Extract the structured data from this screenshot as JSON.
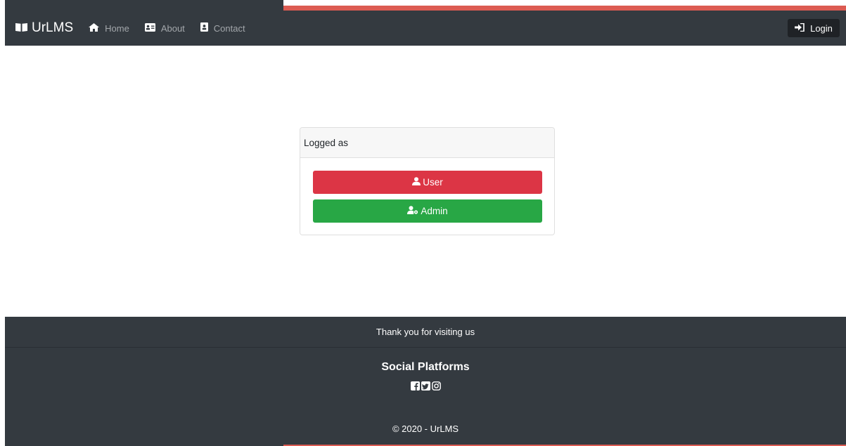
{
  "navbar": {
    "brand": "UrLMS",
    "links": [
      {
        "label": "Home",
        "icon": "home-icon"
      },
      {
        "label": "About",
        "icon": "id-card-icon"
      },
      {
        "label": "Contact",
        "icon": "address-book-icon"
      }
    ],
    "login_label": "Login"
  },
  "card": {
    "header": "Logged as",
    "user_label": "User",
    "admin_label": "Admin"
  },
  "footer": {
    "thanks": "Thank you for visiting us",
    "social_title": "Social Platforms",
    "social_icons": [
      "facebook-icon",
      "twitter-icon",
      "instagram-icon"
    ],
    "copyright": "© 2020 - UrLMS"
  },
  "colors": {
    "navbar_bg": "#343a40",
    "accent_red": "#dc5b52",
    "user_button": "#dc3545",
    "admin_button": "#28a745"
  }
}
